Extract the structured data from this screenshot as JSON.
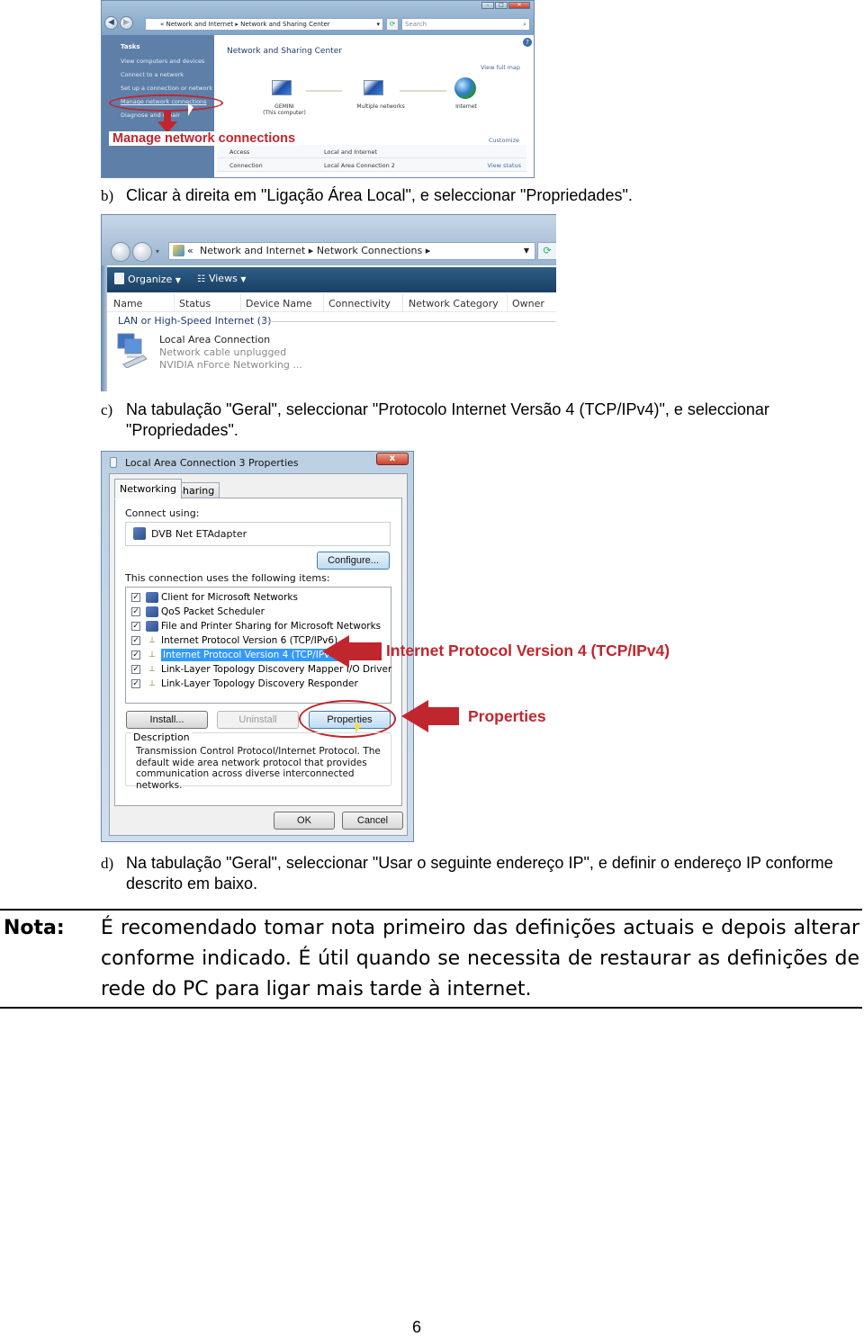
{
  "screenshot1": {
    "window_buttons": [
      "minimize",
      "maximize",
      "close"
    ],
    "address_path": [
      "Network and Internet",
      "Network and Sharing Center"
    ],
    "search_placeholder": "Search",
    "sidebar": {
      "header": "Tasks",
      "items": [
        "View computers and devices",
        "Connect to a network",
        "Set up a connection or network",
        "Manage network connections",
        "Diagnose and repair"
      ]
    },
    "title": "Network and Sharing Center",
    "view_full_map": "View full map",
    "nodes": [
      {
        "label": "GEMINI",
        "sublabel": "(This computer)"
      },
      {
        "label": "Multiple networks",
        "sublabel": ""
      },
      {
        "label": "Internet",
        "sublabel": ""
      }
    ],
    "customize": "Customize",
    "rows": [
      {
        "label": "Access",
        "value": "Local and Internet",
        "action": ""
      },
      {
        "label": "Connection",
        "value": "Local Area Connection 2",
        "action": "View status"
      }
    ],
    "callout": "Manage network connections"
  },
  "step_b": {
    "marker": "b)",
    "text": "Clicar à direita em \"Ligação Área Local\", e seleccionar \"Propriedades\"."
  },
  "screenshot2": {
    "address_path": [
      "Network and Internet",
      "Network Connections"
    ],
    "toolbar": {
      "organize": "Organize",
      "views": "Views"
    },
    "columns": [
      "Name",
      "Status",
      "Device Name",
      "Connectivity",
      "Network Category",
      "Owner"
    ],
    "group": "LAN or High-Speed Internet (3)",
    "connection": {
      "name": "Local Area Connection",
      "status": "Network cable unplugged",
      "device": "NVIDIA nForce Networking ..."
    }
  },
  "step_c": {
    "marker": "c)",
    "text": "Na tabulação \"Geral\", seleccionar \"Protocolo Internet Versão 4 (TCP/IPv4)\", e seleccionar \"Propriedades\"."
  },
  "screenshot3": {
    "title": "Local Area Connection 3 Properties",
    "close": "x",
    "tabs": [
      "Networking",
      "Sharing"
    ],
    "connect_using_label": "Connect using:",
    "adapter": "DVB Net ETAdapter",
    "configure": "Configure...",
    "items_label": "This connection uses the following items:",
    "items": [
      {
        "label": "Client for Microsoft Networks",
        "checked": true,
        "selected": false
      },
      {
        "label": "QoS Packet Scheduler",
        "checked": true,
        "selected": false
      },
      {
        "label": "File and Printer Sharing for Microsoft Networks",
        "checked": true,
        "selected": false
      },
      {
        "label": "Internet Protocol Version 6 (TCP/IPv6)",
        "checked": true,
        "selected": false
      },
      {
        "label": "Internet Protocol Version 4 (TCP/IPv4)",
        "checked": true,
        "selected": true
      },
      {
        "label": "Link-Layer Topology Discovery Mapper I/O Driver",
        "checked": true,
        "selected": false
      },
      {
        "label": "Link-Layer Topology Discovery Responder",
        "checked": true,
        "selected": false
      }
    ],
    "install": "Install...",
    "uninstall": "Uninstall",
    "properties": "Properties",
    "description_label": "Description",
    "description": "Transmission Control Protocol/Internet Protocol. The default wide area network protocol that provides communication across diverse interconnected networks.",
    "ok": "OK",
    "cancel": "Cancel"
  },
  "annotations": {
    "ipv4": "Internet Protocol Version 4 (TCP/IPv4)",
    "properties": "Properties"
  },
  "step_d": {
    "marker": "d)",
    "text": "Na tabulação \"Geral\", seleccionar \"Usar o seguinte endereço IP\", e definir o endereço IP conforme descrito em baixo."
  },
  "note": {
    "label": "Nota:",
    "text": "É recomendado tomar nota primeiro das definições actuais e depois alterar conforme indicado. É útil quando se necessita de restaurar as definições de rede do PC para ligar mais tarde à internet."
  },
  "page_number": "6",
  "colors": {
    "annotation_red": "#c0262e",
    "selection_blue": "#3399ff"
  }
}
